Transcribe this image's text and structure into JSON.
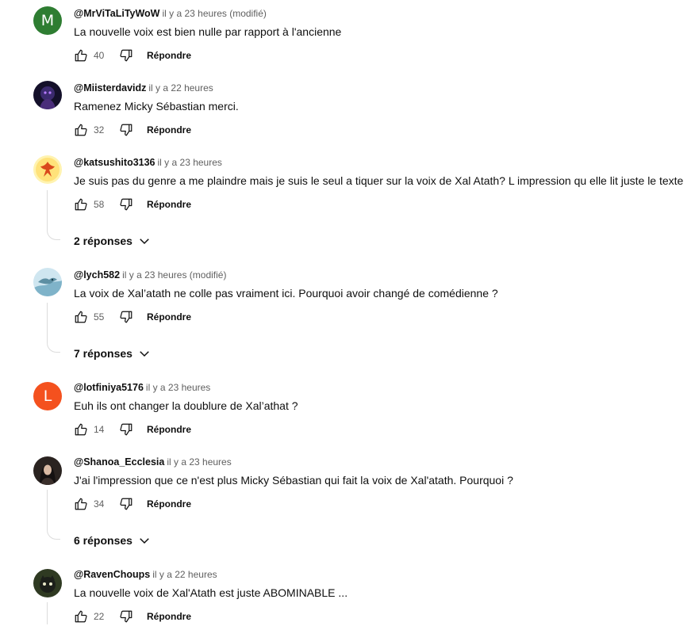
{
  "comments": [
    {
      "author": "@MrViTaLiTyWoW",
      "time": "il y a 23 heures (modifié)",
      "text": "La nouvelle voix est bien nulle par rapport à l'ancienne",
      "likes": "40",
      "reply_label": "Répondre",
      "avatar_letter": "M",
      "avatar_color": "#2e7d32"
    },
    {
      "author": "@Miisterdavidz",
      "time": "il y a 22 heures",
      "text": "Ramenez Micky Sébastian merci.",
      "likes": "32",
      "reply_label": "Répondre"
    },
    {
      "author": "@katsushito3136",
      "time": "il y a 23 heures",
      "text": "Je suis pas du genre a me plaindre mais je suis le seul a tiquer sur la voix de Xal Atath? L impression qu elle lit juste le texte",
      "likes": "58",
      "reply_label": "Répondre",
      "replies": "2 réponses"
    },
    {
      "author": "@lych582",
      "time": "il y a 23 heures (modifié)",
      "text": "La voix de Xal’atath ne colle pas vraiment ici. Pourquoi avoir changé de comédienne ?",
      "likes": "55",
      "reply_label": "Répondre",
      "replies": "7 réponses"
    },
    {
      "author": "@lotfiniya5176",
      "time": "il y a 23 heures",
      "text": "Euh ils ont changer la doublure de Xal’athat ?",
      "likes": "14",
      "reply_label": "Répondre",
      "avatar_letter": "L",
      "avatar_color": "#f4511e"
    },
    {
      "author": "@Shanoa_Ecclesia",
      "time": "il y a 23 heures",
      "text": "J'ai l'impression que ce n'est plus Micky Sébastian qui fait la voix de Xal'atath. Pourquoi ?",
      "likes": "34",
      "reply_label": "Répondre",
      "replies": "6 réponses"
    },
    {
      "author": "@RavenChoups",
      "time": "il y a 22 heures",
      "text": "La nouvelle voix de Xal'Atath est juste ABOMINABLE ...",
      "likes": "22",
      "reply_label": "Répondre"
    }
  ]
}
